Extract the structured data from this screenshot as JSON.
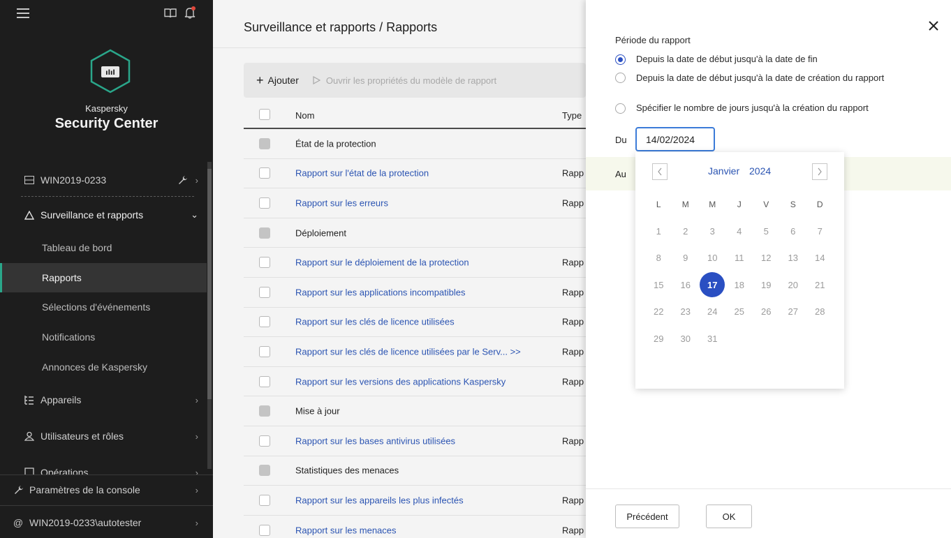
{
  "sidebar": {
    "brand_small": "Kaspersky",
    "brand_big": "Security Center",
    "server": "WIN2019-0233",
    "monitoring": "Surveillance et rapports",
    "sub_items": [
      "Tableau de bord",
      "Rapports",
      "Sélections d'événements",
      "Notifications",
      "Annonces de Kaspersky"
    ],
    "devices": "Appareils",
    "users": "Utilisateurs et rôles",
    "operations": "Opérations",
    "console_settings": "Paramètres de la console",
    "account": "WIN2019-0233\\autotester",
    "active_sub": "Rapports"
  },
  "main": {
    "breadcrumb": "Surveillance et rapports  /  Rapports",
    "toolbar": {
      "add_label": "Ajouter",
      "open_label": "Ouvrir les propriétés du modèle de rapport"
    },
    "table": {
      "col_name": "Nom",
      "col_type": "Type",
      "rows": [
        {
          "name": "État de la protection",
          "type": "",
          "group": true
        },
        {
          "name": "Rapport sur l'état de la protection",
          "type": "Rapp",
          "group": false
        },
        {
          "name": "Rapport sur les erreurs",
          "type": "Rapp",
          "group": false
        },
        {
          "name": "Déploiement",
          "type": "",
          "group": true
        },
        {
          "name": "Rapport sur le déploiement de la protection",
          "type": "Rapp",
          "group": false
        },
        {
          "name": "Rapport sur les applications incompatibles",
          "type": "Rapp",
          "group": false
        },
        {
          "name": "Rapport sur les clés de licence utilisées",
          "type": "Rapp",
          "group": false
        },
        {
          "name": "Rapport sur les clés de licence utilisées par le Serv...  >>",
          "type": "Rapp",
          "group": false
        },
        {
          "name": "Rapport sur les versions des applications Kaspersky",
          "type": "Rapp",
          "group": false
        },
        {
          "name": "Mise à jour",
          "type": "",
          "group": true
        },
        {
          "name": "Rapport sur les bases antivirus utilisées",
          "type": "Rapp",
          "group": false
        },
        {
          "name": "Statistiques des menaces",
          "type": "",
          "group": true
        },
        {
          "name": "Rapport sur les appareils les plus infectés",
          "type": "Rapp",
          "group": false
        },
        {
          "name": "Rapport sur les menaces",
          "type": "Rapp",
          "group": false
        }
      ]
    }
  },
  "panel": {
    "period_title": "Période du rapport",
    "options": [
      {
        "label": "Depuis la date de début jusqu'à la date de fin",
        "selected": true
      },
      {
        "label": "Depuis la date de début jusqu'à la date de création du rapport",
        "selected": false
      },
      {
        "label": "Spécifier le nombre de jours jusqu'à la création du rapport",
        "selected": false
      }
    ],
    "from_label": "Du",
    "from_value": "14/02/2024",
    "to_label": "Au",
    "calendar": {
      "month": "Janvier",
      "year": "2024",
      "weekdays": [
        "L",
        "M",
        "M",
        "J",
        "V",
        "S",
        "D"
      ],
      "days": [
        "1",
        "2",
        "3",
        "4",
        "5",
        "6",
        "7",
        "8",
        "9",
        "10",
        "11",
        "12",
        "13",
        "14",
        "15",
        "16",
        "17",
        "18",
        "19",
        "20",
        "21",
        "22",
        "23",
        "24",
        "25",
        "26",
        "27",
        "28",
        "29",
        "30",
        "31"
      ],
      "selected_day": "17"
    },
    "prev_button": "Précédent",
    "ok_button": "OK"
  },
  "colors": {
    "sidebar_bg": "#1d1d1d",
    "accent_green": "#2aa68a",
    "link_blue": "#2b54b2",
    "selection_blue": "#2a4fc2"
  }
}
